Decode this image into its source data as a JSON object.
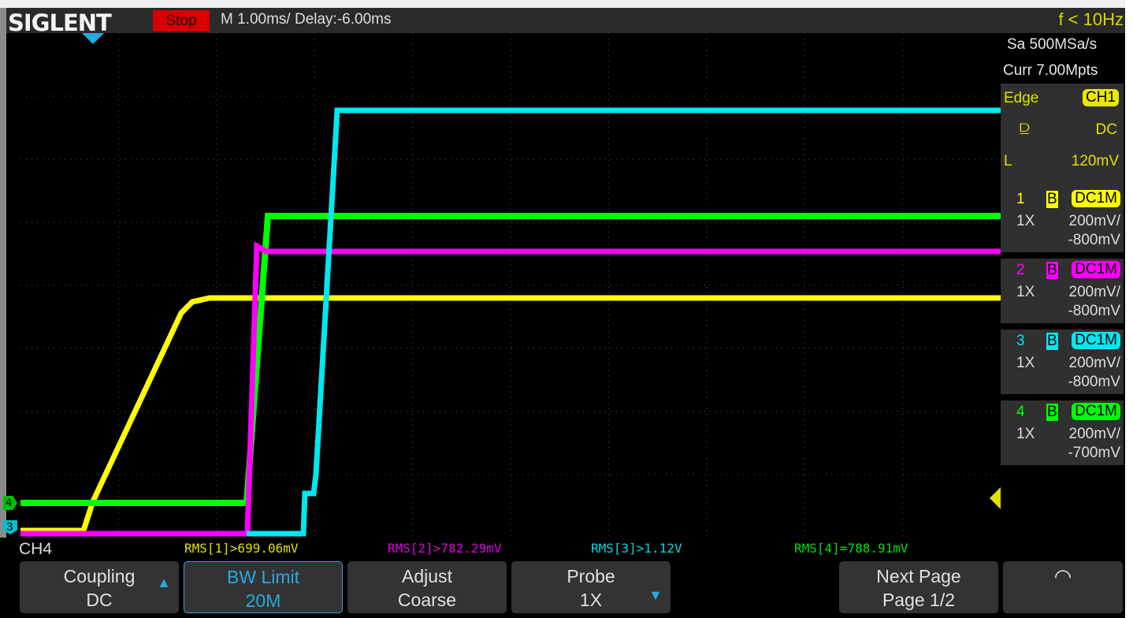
{
  "header": {
    "brand": "SIGLENT",
    "run_state": "Stop",
    "timebase": "M 1.00ms/ Delay:-6.00ms",
    "trigger_freq": "f < 10Hz"
  },
  "acquisition": {
    "sample_rate": "Sa 500MSa/s",
    "memory": "Curr 7.00Mpts"
  },
  "trigger": {
    "type": "Edge",
    "source": "CH1",
    "slope_icon": "rising-edge-icon",
    "coupling": "DC",
    "level_label": "L",
    "level": "120mV"
  },
  "channels": [
    {
      "num": "1",
      "bw": "B",
      "coupling": "DC1M",
      "probe": "1X",
      "scale": "200mV/",
      "offset": "-800mV",
      "color": "#ffff00"
    },
    {
      "num": "2",
      "bw": "B",
      "coupling": "DC1M",
      "probe": "1X",
      "scale": "200mV/",
      "offset": "-800mV",
      "color": "#ff00ff"
    },
    {
      "num": "3",
      "bw": "B",
      "coupling": "DC1M",
      "probe": "1X",
      "scale": "200mV/",
      "offset": "-800mV",
      "color": "#00e8f0"
    },
    {
      "num": "4",
      "bw": "B",
      "coupling": "DC1M",
      "probe": "1X",
      "scale": "200mV/",
      "offset": "-700mV",
      "color": "#00ff00"
    }
  ],
  "markers": {
    "ch4": "4",
    "ch3": "3"
  },
  "measurements": {
    "active_channel": "CH4",
    "rms1": "RMS[1]>699.06mV",
    "rms2": "RMS[2]>782.29mV",
    "rms3": "RMS[3]>1.12V",
    "rms4": "RMS[4]=788.91mV"
  },
  "menu": [
    {
      "line1": "Coupling",
      "line2": "DC"
    },
    {
      "line1": "BW Limit",
      "line2": "20M"
    },
    {
      "line1": "Adjust",
      "line2": "Coarse"
    },
    {
      "line1": "Probe",
      "line2": "1X"
    },
    {
      "line1": "Next Page",
      "line2": "Page 1/2"
    }
  ]
}
